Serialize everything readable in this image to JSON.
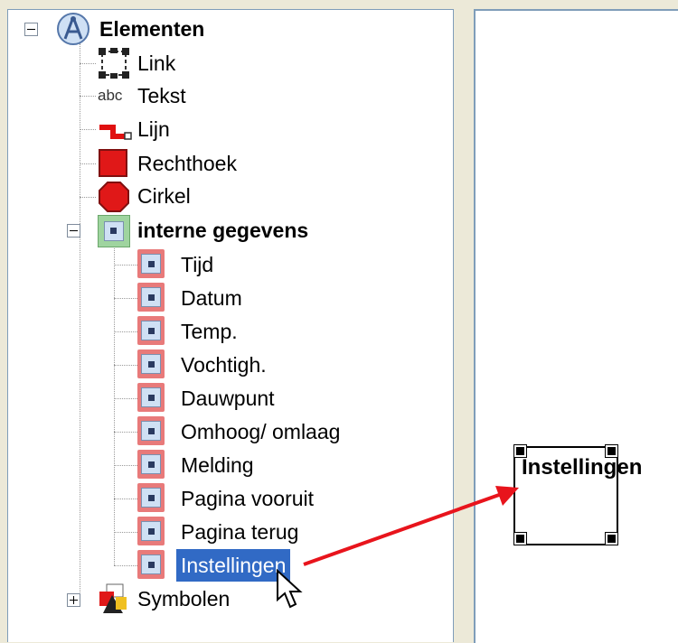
{
  "tree": {
    "root_label": "Elementen",
    "items": [
      {
        "label": "Link",
        "icon": "link-frame-icon"
      },
      {
        "label": "Tekst",
        "icon_text": "abc"
      },
      {
        "label": "Lijn",
        "icon": "line-icon"
      },
      {
        "label": "Rechthoek",
        "icon": "rectangle-icon"
      },
      {
        "label": "Cirkel",
        "icon": "circle-icon"
      }
    ],
    "group_label": "interne gegevens",
    "group_items": [
      {
        "label": "Tijd"
      },
      {
        "label": "Datum"
      },
      {
        "label": "Temp."
      },
      {
        "label": "Vochtigh."
      },
      {
        "label": "Dauwpunt"
      },
      {
        "label": "Omhoog/ omlaag"
      },
      {
        "label": "Melding"
      },
      {
        "label": "Pagina vooruit"
      },
      {
        "label": "Pagina terug"
      },
      {
        "label": "Instellingen",
        "selected": true
      }
    ],
    "symbols_label": "Symbolen"
  },
  "canvas": {
    "element_text": "Instellingen"
  },
  "colors": {
    "selection": "#316ac5",
    "arrow": "#e8141c",
    "data_icon": "#e87a7a"
  }
}
